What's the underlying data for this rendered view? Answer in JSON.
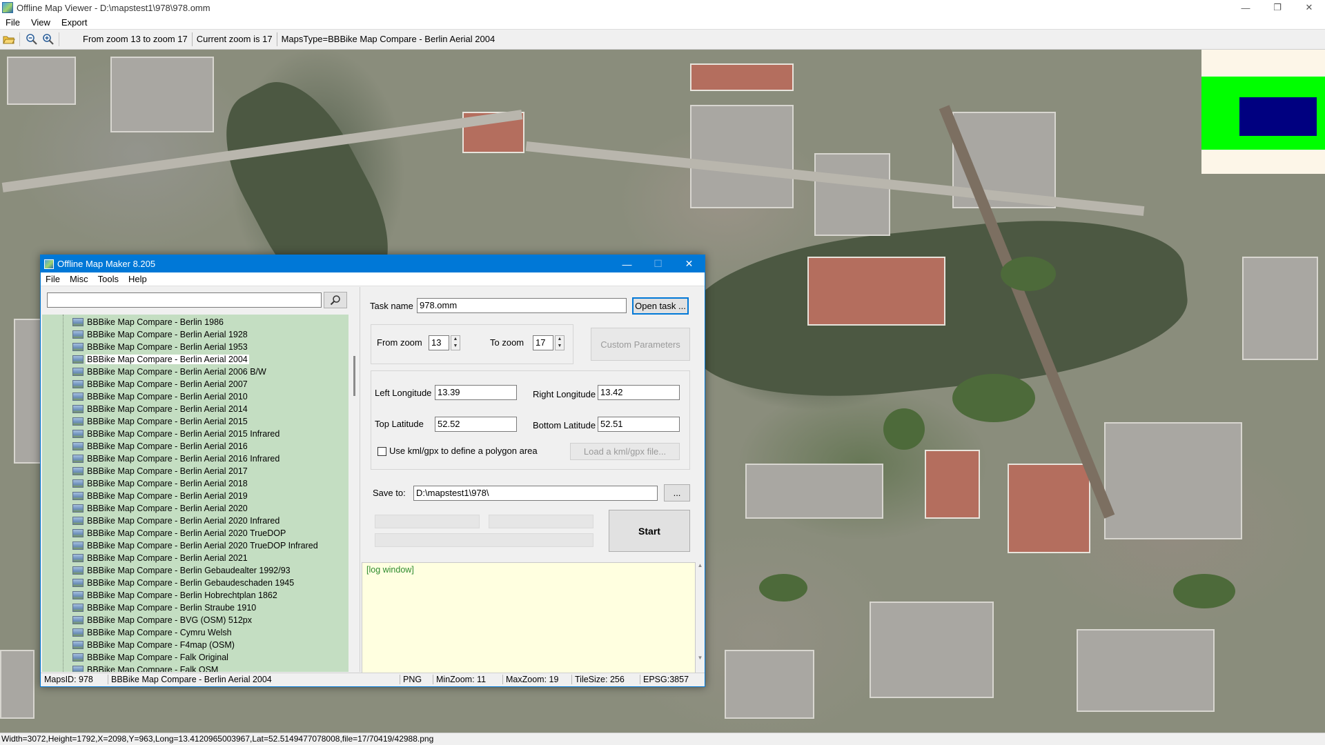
{
  "window": {
    "title": "Offline Map Viewer - D:\\mapstest1\\978\\978.omm",
    "min_glyph": "—",
    "max_glyph": "❐",
    "close_glyph": "✕"
  },
  "menu": {
    "file": "File",
    "view": "View",
    "export": "Export"
  },
  "toolbar": {
    "icons": [
      "open-folder-icon",
      "zoom-out-icon",
      "zoom-in-icon"
    ],
    "zoom_range": "From zoom 13 to zoom 17",
    "current_zoom": "Current zoom is 17",
    "maps_type": "MapsType=BBBike Map Compare - Berlin Aerial 2004"
  },
  "overview": {
    "colors": {
      "background": "#fdf6e8",
      "region": "#00ff00",
      "viewport": "#000080"
    }
  },
  "status_line": "Width=3072,Height=1792,X=2098,Y=963,Long=13.4120965003967,Lat=52.5149477078008,file=17/70419/42988.png",
  "dialog": {
    "title": "Offline Map Maker 8.205",
    "min_glyph": "—",
    "max_glyph": "☐",
    "close_glyph": "✕",
    "menu": {
      "file": "File",
      "misc": "Misc",
      "tools": "Tools",
      "help": "Help"
    },
    "search": {
      "value": "",
      "placeholder": ""
    },
    "list_items": [
      "BBBike Map Compare - Berlin 1986",
      "BBBike Map Compare - Berlin Aerial 1928",
      "BBBike Map Compare - Berlin Aerial 1953",
      "BBBike Map Compare - Berlin Aerial 2004",
      "BBBike Map Compare - Berlin Aerial 2006 B/W",
      "BBBike Map Compare - Berlin Aerial 2007",
      "BBBike Map Compare - Berlin Aerial 2010",
      "BBBike Map Compare - Berlin Aerial 2014",
      "BBBike Map Compare - Berlin Aerial 2015",
      "BBBike Map Compare - Berlin Aerial 2015 Infrared",
      "BBBike Map Compare - Berlin Aerial 2016",
      "BBBike Map Compare - Berlin Aerial 2016 Infrared",
      "BBBike Map Compare - Berlin Aerial 2017",
      "BBBike Map Compare - Berlin Aerial 2018",
      "BBBike Map Compare - Berlin Aerial 2019",
      "BBBike Map Compare - Berlin Aerial 2020",
      "BBBike Map Compare - Berlin Aerial 2020 Infrared",
      "BBBike Map Compare - Berlin Aerial 2020 TrueDOP",
      "BBBike Map Compare - Berlin Aerial 2020 TrueDOP Infrared",
      "BBBike Map Compare - Berlin Aerial 2021",
      "BBBike Map Compare - Berlin Gebaudealter 1992/93",
      "BBBike Map Compare - Berlin Gebaudeschaden 1945",
      "BBBike Map Compare - Berlin Hobrechtplan 1862",
      "BBBike Map Compare - Berlin Straube 1910",
      "BBBike Map Compare - BVG (OSM) 512px",
      "BBBike Map Compare - Cymru Welsh",
      "BBBike Map Compare - F4map (OSM)",
      "BBBike Map Compare - Falk Original",
      "BBBike Map Compare - Falk OSM"
    ],
    "selected_item": "BBBike Map Compare - Berlin Aerial 2004",
    "task_name_label": "Task name",
    "task_name_value": "978.omm",
    "open_task_button": "Open task ...",
    "from_zoom_label": "From zoom",
    "from_zoom_value": "13",
    "to_zoom_label": "To zoom",
    "to_zoom_value": "17",
    "custom_params_button": "Custom Parameters",
    "left_lon_label": "Left Longitude",
    "left_lon_value": "13.39",
    "right_lon_label": "Right Longitude",
    "right_lon_value": "13.42",
    "top_lat_label": "Top Latitude",
    "top_lat_value": "52.52",
    "bottom_lat_label": "Bottom Latitude",
    "bottom_lat_value": "52.51",
    "kml_checkbox_label": "Use kml/gpx to define a polygon area",
    "kml_checked": false,
    "load_kml_button": "Load a kml/gpx file...",
    "save_to_label": "Save to:",
    "save_to_value": "D:\\mapstest1\\978\\",
    "browse_button": "...",
    "start_button": "Start",
    "progress": [
      0,
      0,
      0
    ],
    "log_text": "[log window]",
    "status": {
      "maps_id": "MapsID: 978",
      "maps_name": "BBBike Map Compare - Berlin Aerial 2004",
      "format": "PNG",
      "min_zoom": "MinZoom: 11",
      "max_zoom": "MaxZoom: 19",
      "tile_size": "TileSize: 256",
      "epsg": "EPSG:3857"
    }
  }
}
